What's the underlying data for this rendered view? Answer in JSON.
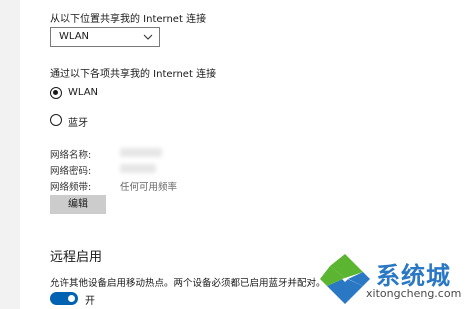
{
  "share_from": {
    "label": "从以下位置共享我的 Internet 连接",
    "selected": "WLAN"
  },
  "share_over": {
    "label": "通过以下各项共享我的 Internet 连接",
    "options": [
      {
        "label": "WLAN",
        "selected": true
      },
      {
        "label": "蓝牙",
        "selected": false
      }
    ]
  },
  "network_info": {
    "name_label": "网络名称:",
    "password_label": "网络密码:",
    "band_label": "网络频带:",
    "band_value": "任何可用频率"
  },
  "edit_button_label": "编辑",
  "remote_enable": {
    "heading": "远程启用",
    "description": "允许其他设备启用移动热点。两个设备必须都已启用蓝牙并配对。",
    "toggle_state": "开",
    "toggle_on": true
  },
  "watermark": {
    "name": "系统城",
    "url": "xitongcheng.com"
  },
  "colors": {
    "accent": "#0063b1",
    "watermark_blue": "#2a78c4",
    "watermark_green": "#5bb531"
  }
}
